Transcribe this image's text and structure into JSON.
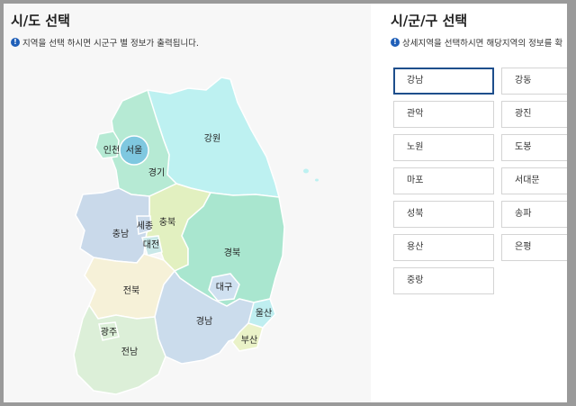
{
  "province_panel": {
    "title": "시/도 선택",
    "info": "지역을 선택 하시면 시군구 별 정보가 출력됩니다.",
    "regions": [
      {
        "id": "gangwon",
        "label": "강원",
        "color": "#bdf1f1"
      },
      {
        "id": "gyeonggi",
        "label": "경기",
        "color": "#b6ead4"
      },
      {
        "id": "incheon",
        "label": "인천",
        "color": "#b6ead4"
      },
      {
        "id": "seoul",
        "label": "서울",
        "color": "#7fc8e0"
      },
      {
        "id": "chungbuk",
        "label": "충북",
        "color": "#e2f0c0"
      },
      {
        "id": "chungnam",
        "label": "충남",
        "color": "#c9d9ea"
      },
      {
        "id": "sejong",
        "label": "세종",
        "color": "#c9d9ea"
      },
      {
        "id": "daejeon",
        "label": "대전",
        "color": "#c9e8e8"
      },
      {
        "id": "gyeongbuk",
        "label": "경북",
        "color": "#a9e6cf"
      },
      {
        "id": "daegu",
        "label": "대구",
        "color": "#cfe0f0"
      },
      {
        "id": "jeonbuk",
        "label": "전북",
        "color": "#f6f1d8"
      },
      {
        "id": "gyeongnam",
        "label": "경남",
        "color": "#cbdcec"
      },
      {
        "id": "ulsan",
        "label": "울산",
        "color": "#bfeef0"
      },
      {
        "id": "busan",
        "label": "부산",
        "color": "#eaf2c8"
      },
      {
        "id": "gwangju",
        "label": "광주",
        "color": "#dcefd8"
      },
      {
        "id": "jeonnam",
        "label": "전남",
        "color": "#dcefd8"
      }
    ]
  },
  "district_panel": {
    "title": "시/군/구 선택",
    "info": "상세지역을 선택하시면 해당지역의 정보를 확",
    "selected": "강남",
    "districts": [
      "강남",
      "강동",
      "관악",
      "광진",
      "노원",
      "도봉",
      "마포",
      "서대문",
      "성북",
      "송파",
      "용산",
      "은평",
      "중랑"
    ]
  },
  "colors": {
    "background": "#f7f7f7",
    "accent": "#1e4e8c",
    "info_icon": "#1f5fb8"
  }
}
